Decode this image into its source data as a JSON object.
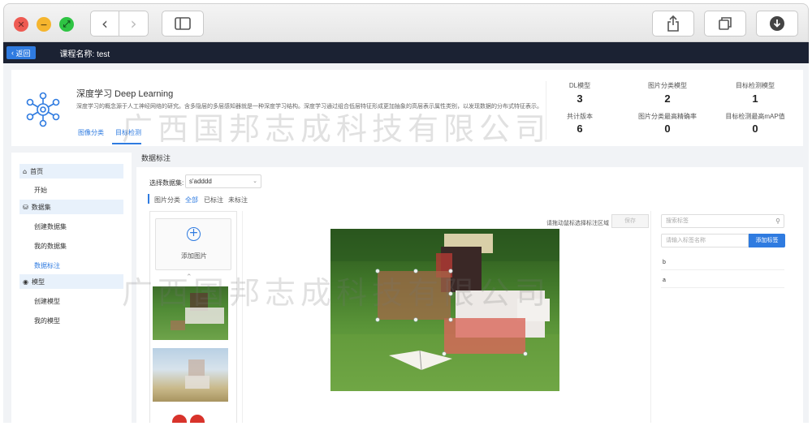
{
  "topbar": {
    "back_label": "返回",
    "course_name": "课程名称: test"
  },
  "header": {
    "title": "深度学习 Deep Learning",
    "description": "深度学习的概念源于人工神经网络的研究。含多隐层的多层感知器就是一种深度学习结构。深度学习通过组合低层特征形成更加抽象的高层表示属性类别，以发现数据的分布式特征表示。",
    "tabs": [
      "图像分类",
      "目标检测"
    ],
    "stats": [
      {
        "label": "DL模型",
        "value": "3"
      },
      {
        "label": "图片分类模型",
        "value": "2"
      },
      {
        "label": "目标检测模型",
        "value": "1"
      },
      {
        "label": "共计版本",
        "value": "6"
      },
      {
        "label": "图片分类最高精确率",
        "value": "0"
      },
      {
        "label": "目标检测最高mAP值",
        "value": "0"
      }
    ]
  },
  "sidebar": {
    "sections": [
      {
        "label": "首页",
        "icon": "home-icon",
        "items": [
          "开始"
        ]
      },
      {
        "label": "数据集",
        "icon": "database-icon",
        "items": [
          "创建数据集",
          "我的数据集",
          "数据标注"
        ]
      },
      {
        "label": "模型",
        "icon": "model-icon",
        "items": [
          "创建模型",
          "我的模型"
        ]
      }
    ]
  },
  "main": {
    "title": "数据标注",
    "dataset_label": "选择数据集:",
    "dataset_value": "s'adddd",
    "filters": [
      "图片分类",
      "全部",
      "已标注",
      "未标注"
    ],
    "add_image_label": "添加图片",
    "hint": "请拖动鼠标选择标注区域",
    "save_label": "保存",
    "search_placeholder": "搜索标签",
    "label_placeholder": "请输入标签名称",
    "add_label_button": "添加标签",
    "tags": [
      "b",
      "a"
    ]
  },
  "watermark": "广西国邦志成科技有限公司",
  "colors": {
    "accent": "#2f7be0",
    "topbar": "#1b2233",
    "sidebar_highlight": "#e8f1fb"
  }
}
